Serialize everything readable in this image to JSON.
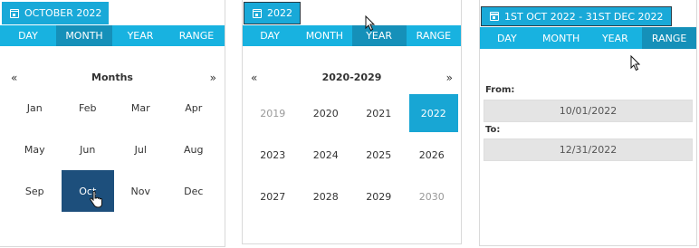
{
  "month_picker": {
    "header": "OCTOBER 2022",
    "modes": [
      "DAY",
      "MONTH",
      "YEAR",
      "RANGE"
    ],
    "active_mode": "MONTH",
    "prev": "«",
    "next": "»",
    "title": "Months",
    "items": [
      "Jan",
      "Feb",
      "Mar",
      "Apr",
      "May",
      "Jun",
      "Jul",
      "Aug",
      "Sep",
      "Oct",
      "Nov",
      "Dec"
    ],
    "selected": "Oct"
  },
  "year_picker": {
    "header": "2022",
    "modes": [
      "DAY",
      "MONTH",
      "YEAR",
      "RANGE"
    ],
    "active_mode": "YEAR",
    "prev": "«",
    "next": "»",
    "title": "2020-2029",
    "items": [
      "2019",
      "2020",
      "2021",
      "2022",
      "2023",
      "2024",
      "2025",
      "2026",
      "2027",
      "2028",
      "2029",
      "2030"
    ],
    "muted": [
      "2019",
      "2030"
    ],
    "selected": "2022"
  },
  "range_picker": {
    "header": "1ST OCT 2022 - 31ST DEC 2022",
    "modes": [
      "DAY",
      "MONTH",
      "YEAR",
      "RANGE"
    ],
    "active_mode": "RANGE",
    "from_label": "From:",
    "from_value": "10/01/2022",
    "to_label": "To:",
    "to_value": "12/31/2022"
  },
  "colors": {
    "header_bg": "#19a9d8",
    "mode_bar": "#18b2e0",
    "mode_active": "#1590b9",
    "selected_month": "#1d4f7c",
    "selected_year": "#18a6d4",
    "field_bg": "#e4e4e4"
  }
}
